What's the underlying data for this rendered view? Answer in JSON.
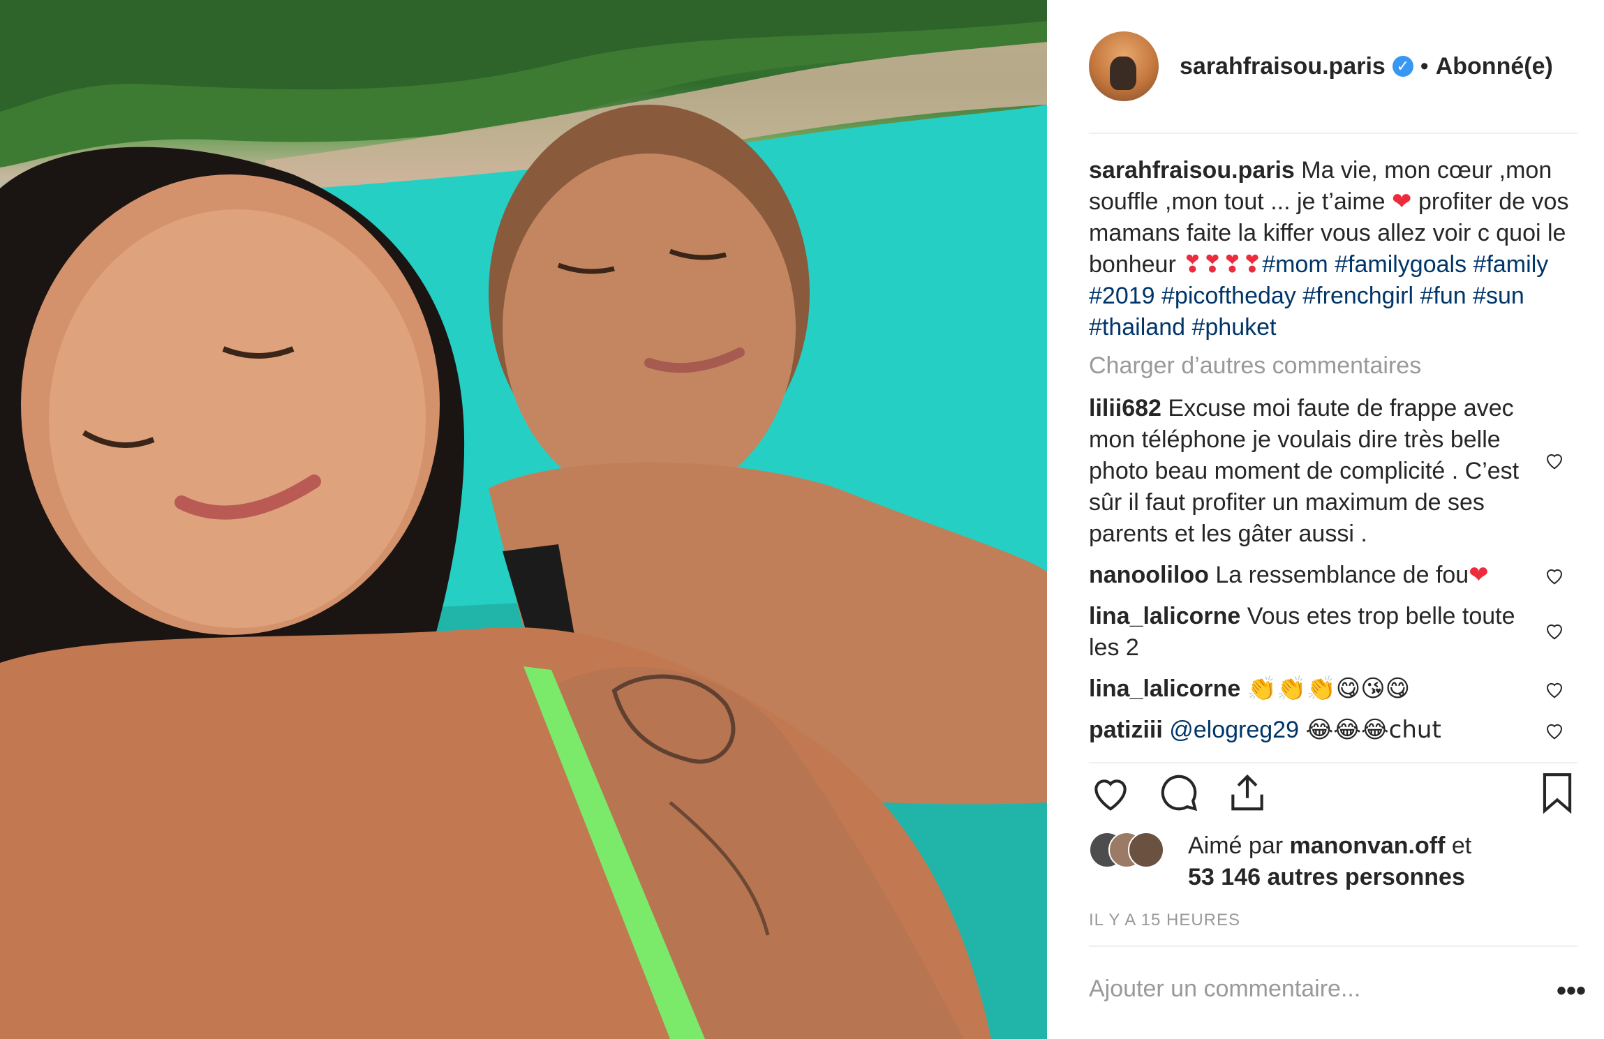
{
  "post": {
    "username": "sarahfraisou.paris",
    "verified_icon": "check-icon",
    "separator": "•",
    "follow_state": "Abonné(e)"
  },
  "caption": {
    "username": "sarahfraisou.paris",
    "text_1": "Ma vie, mon cœur ,mon souffle ,mon tout ... je t’aime",
    "text_2": "profiter de vos mamans faite la kiffer vous allez voir c quoi le bonheur",
    "hashtags": [
      "#mom",
      "#familygoals",
      "#family",
      "#2019",
      "#picoftheday",
      "#frenchgirl",
      "#fun",
      "#sun",
      "#thailand",
      "#phuket"
    ]
  },
  "load_more": "Charger d’autres commentaires",
  "comments": [
    {
      "username": "lilii682",
      "text": "Excuse moi faute de frappe avec mon téléphone je voulais dire très belle photo beau moment de complicité . C’est sûr il faut profiter un maximum de ses parents et les gâter aussi ."
    },
    {
      "username": "nanooliloo",
      "text": "La ressemblance de fou"
    },
    {
      "username": "lina_lalicorne",
      "text": "Vous etes trop belle toute les 2"
    },
    {
      "username": "lina_lalicorne",
      "text": "👏👏👏😋😘😋"
    },
    {
      "username": "patiziii",
      "mention": "@elogreg29",
      "text": "😂😂😂chut"
    }
  ],
  "likes": {
    "prefix": "Aimé par",
    "user": "manonvan.off",
    "conj": "et",
    "others": "53 146 autres personnes"
  },
  "timestamp": "IL Y A 15 HEURES",
  "add_comment_placeholder": "Ajouter un commentaire...",
  "more_label": "•••",
  "icons": {
    "like": "heart-outline-icon",
    "comment": "comment-bubble-icon",
    "share": "share-icon",
    "save": "bookmark-icon",
    "caption_heart": "red-heart-emoji",
    "comment_like": "small-heart-outline-icon"
  },
  "colors": {
    "text": "#262626",
    "muted": "#999999",
    "hashtag": "#003569",
    "verified": "#3897f0",
    "heart_red": "#ed2b3c"
  }
}
